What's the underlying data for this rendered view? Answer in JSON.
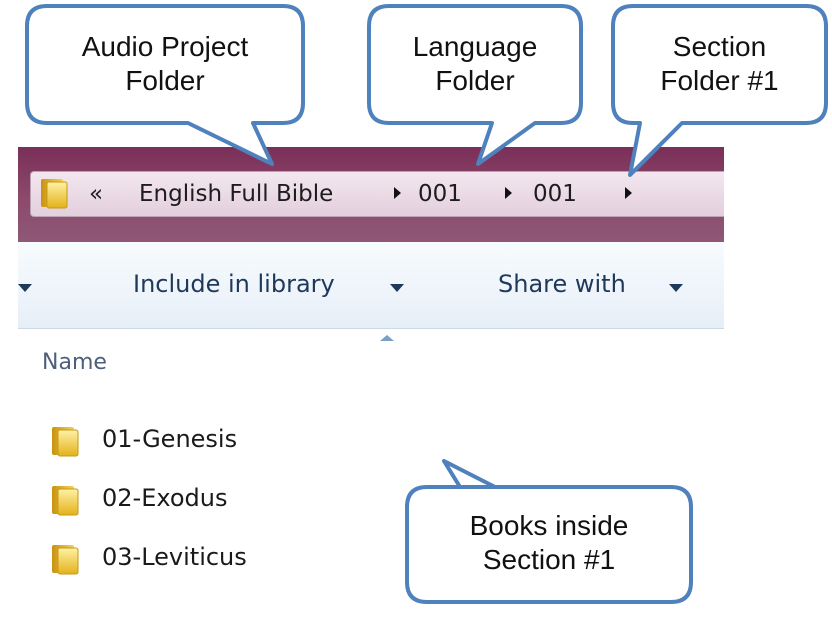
{
  "address_bar": {
    "overflow_glyph": "«",
    "segments": [
      "English Full Bible",
      "001",
      "001"
    ]
  },
  "toolbar": {
    "include_label": "Include in library",
    "share_label": "Share with"
  },
  "file_list": {
    "column_name": "Name",
    "items": [
      {
        "name": "01-Genesis",
        "icon": "folder-icon"
      },
      {
        "name": "02-Exodus",
        "icon": "folder-icon"
      },
      {
        "name": "03-Leviticus",
        "icon": "folder-icon"
      }
    ]
  },
  "callouts": {
    "audio_project": {
      "line1": "Audio Project",
      "line2": "Folder"
    },
    "language": {
      "line1": "Language",
      "line2": "Folder"
    },
    "section": {
      "line1": "Section",
      "line2": "Folder #1"
    },
    "books": {
      "line1": "Books inside",
      "line2": "Section #1"
    }
  },
  "colors": {
    "callout_border": "#4f81bd",
    "frame": "#7a2f58",
    "folder": "#e8b722",
    "toolbar_text": "#1e395b"
  }
}
